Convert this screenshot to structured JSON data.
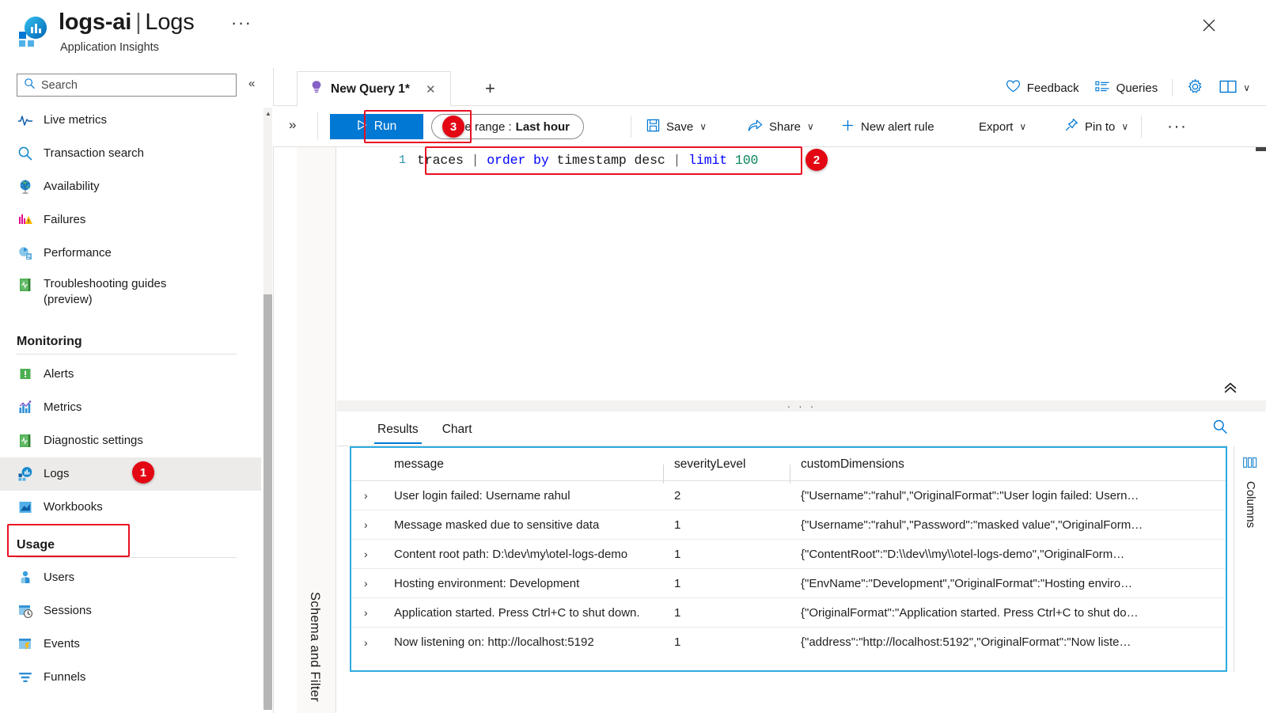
{
  "header": {
    "resource_name": "logs-ai",
    "separator": "|",
    "page_name": "Logs",
    "subtitle": "Application Insights",
    "ellipsis": "···",
    "close_label": "✕"
  },
  "sidebar": {
    "search_placeholder": "Search",
    "search_value": "",
    "collapse_label": "«",
    "items": [
      {
        "label": "Live metrics",
        "icon": "live-metrics-icon",
        "selected": false
      },
      {
        "label": "Transaction search",
        "icon": "search-icon",
        "selected": false
      },
      {
        "label": "Availability",
        "icon": "globe-icon",
        "selected": false
      },
      {
        "label": "Failures",
        "icon": "failures-icon",
        "selected": false
      },
      {
        "label": "Performance",
        "icon": "performance-icon",
        "selected": false
      },
      {
        "label": "Troubleshooting guides (preview)",
        "icon": "troubleshooting-guides-icon",
        "selected": false,
        "two_line": true,
        "line1": "Troubleshooting guides",
        "line2": "(preview)"
      }
    ],
    "groups": [
      {
        "title": "Monitoring",
        "items": [
          {
            "label": "Alerts",
            "icon": "alerts-icon",
            "selected": false
          },
          {
            "label": "Metrics",
            "icon": "metrics-icon",
            "selected": false
          },
          {
            "label": "Diagnostic settings",
            "icon": "diagnostic-settings-icon",
            "selected": false
          },
          {
            "label": "Logs",
            "icon": "logs-icon",
            "selected": true
          },
          {
            "label": "Workbooks",
            "icon": "workbooks-icon",
            "selected": false
          }
        ]
      },
      {
        "title": "Usage",
        "items": [
          {
            "label": "Users",
            "icon": "users-icon",
            "selected": false
          },
          {
            "label": "Sessions",
            "icon": "sessions-icon",
            "selected": false
          },
          {
            "label": "Events",
            "icon": "events-icon",
            "selected": false
          },
          {
            "label": "Funnels",
            "icon": "funnels-icon",
            "selected": false
          }
        ]
      }
    ]
  },
  "annotations": {
    "badge_color": "#e30613",
    "outline_color": "#e81123",
    "markers": [
      {
        "number": "1",
        "target": "sidebar-item-logs"
      },
      {
        "number": "2",
        "target": "query-editor-line"
      },
      {
        "number": "3",
        "target": "run-button"
      }
    ]
  },
  "tabs": {
    "query_tabs": [
      {
        "label": "New Query 1*",
        "icon": "lightbulb-icon",
        "active": true,
        "close_label": "✕"
      }
    ],
    "add_tab_label": "+"
  },
  "top_rail": {
    "feedback_label": "Feedback",
    "queries_label": "Queries",
    "settings_icon": "gear-icon",
    "layout_icon": "book-layout-icon",
    "layout_chevron": "∨"
  },
  "command_bar": {
    "schema_expand_label": "»",
    "run_label": "Run",
    "run_icon": "play-icon",
    "time_range_label": "Time range :",
    "time_range_value": "Last hour",
    "save_label": "Save",
    "share_label": "Share",
    "new_alert_rule_label": "New alert rule",
    "export_label": "Export",
    "pin_to_label": "Pin to",
    "overflow_label": "···",
    "chevron": "∨"
  },
  "schema_panel": {
    "vertical_label": "Schema and Filter"
  },
  "editor": {
    "line_number": "1",
    "query_text": "traces | order by timestamp desc | limit 100",
    "tokens": [
      {
        "text": "traces ",
        "type": "plain"
      },
      {
        "text": "| ",
        "type": "pipe"
      },
      {
        "text": "order by ",
        "type": "keyword"
      },
      {
        "text": "timestamp desc ",
        "type": "plain"
      },
      {
        "text": "| ",
        "type": "pipe"
      },
      {
        "text": "limit ",
        "type": "keyword"
      },
      {
        "text": "100",
        "type": "number"
      }
    ],
    "collapse_label": "«"
  },
  "splitter": {
    "handle_label": "· · ·"
  },
  "results": {
    "tabs": [
      {
        "label": "Results",
        "active": true
      },
      {
        "label": "Chart",
        "active": false
      }
    ],
    "search_icon": "search-icon",
    "columns_panel": {
      "label": "Columns",
      "icon": "columns-icon"
    },
    "table": {
      "columns": [
        "message",
        "severityLevel",
        "customDimensions"
      ],
      "expander_label": "›",
      "rows": [
        {
          "message": "User login failed: Username rahul",
          "severityLevel": "2",
          "customDimensions": "{\"Username\":\"rahul\",\"OriginalFormat\":\"User login failed: Usern…"
        },
        {
          "message": "Message masked due to sensitive data",
          "severityLevel": "1",
          "customDimensions": "{\"Username\":\"rahul\",\"Password\":\"masked value\",\"OriginalForm…"
        },
        {
          "message": "Content root path: D:\\dev\\my\\otel-logs-demo",
          "severityLevel": "1",
          "customDimensions": "{\"ContentRoot\":\"D:\\\\dev\\\\my\\\\otel-logs-demo\",\"OriginalForm…"
        },
        {
          "message": "Hosting environment: Development",
          "severityLevel": "1",
          "customDimensions": "{\"EnvName\":\"Development\",\"OriginalFormat\":\"Hosting enviro…"
        },
        {
          "message": "Application started. Press Ctrl+C to shut down.",
          "severityLevel": "1",
          "customDimensions": "{\"OriginalFormat\":\"Application started. Press Ctrl+C to shut do…"
        },
        {
          "message": "Now listening on: http://localhost:5192",
          "severityLevel": "1",
          "customDimensions": "{\"address\":\"http://localhost:5192\",\"OriginalFormat\":\"Now liste…"
        }
      ]
    }
  }
}
